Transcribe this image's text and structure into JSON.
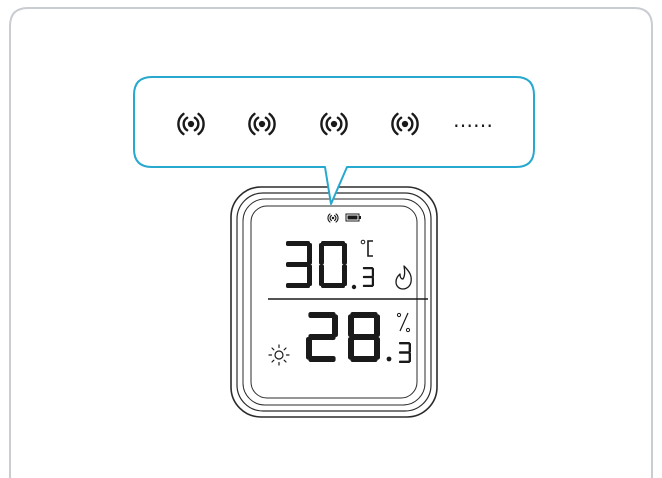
{
  "colors": {
    "panel_border": "#c9cdd2",
    "callout_border": "#27a8cf",
    "callout_fill": "#ffffff",
    "device_outline": "#2b2b2b",
    "lcd_ink": "#1a1a1a"
  },
  "callout": {
    "icons": [
      "wifi-signal-icon",
      "wifi-signal-icon",
      "wifi-signal-icon",
      "wifi-signal-icon"
    ],
    "more_dots": "……"
  },
  "device": {
    "status_icons": [
      "wifi-signal-icon",
      "battery-full-icon"
    ],
    "temperature": {
      "integer": "30",
      "decimal": "3",
      "unit": "°C",
      "indicator_icon": "flame-icon"
    },
    "humidity": {
      "integer": "28",
      "decimal": "3",
      "unit": "%",
      "indicator_icon": "sun-icon"
    }
  }
}
